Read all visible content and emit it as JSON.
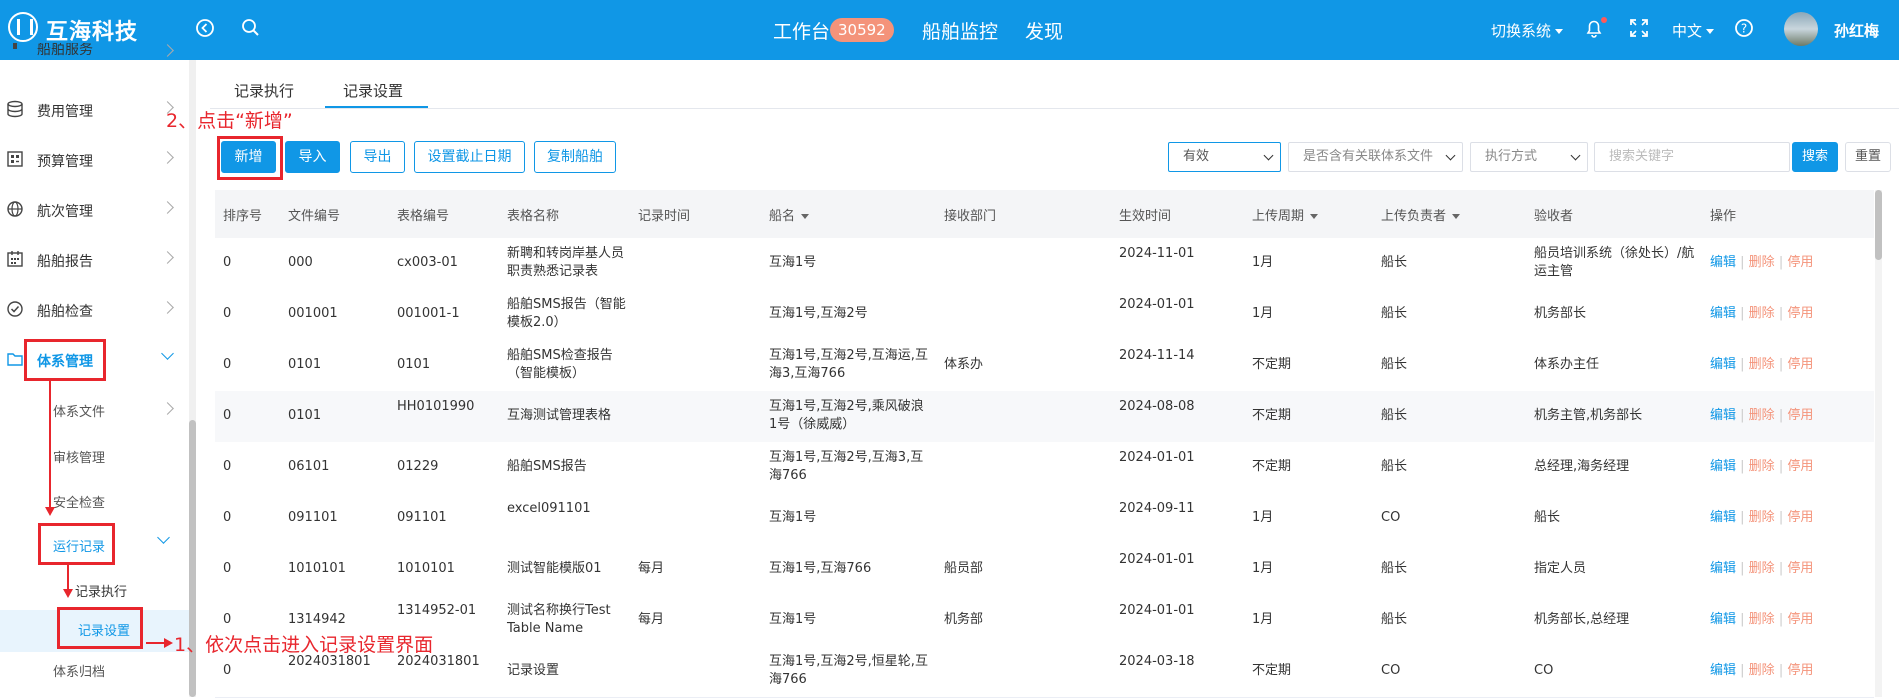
{
  "header": {
    "logo_text": "互海科技",
    "nav": {
      "workbench": "工作台",
      "workbench_count": "30592",
      "ship_monitor": "船舶监控",
      "discover": "发现"
    },
    "switch_system": "切换系统",
    "language": "中文",
    "username": "孙红梅"
  },
  "sidebar": {
    "items": [
      {
        "label": "船舶服务"
      },
      {
        "label": "费用管理"
      },
      {
        "label": "预算管理"
      },
      {
        "label": "航次管理"
      },
      {
        "label": "船舶报告"
      },
      {
        "label": "船舶检查"
      },
      {
        "label": "体系管理"
      }
    ],
    "sub": {
      "system_docs": "体系文件",
      "audit": "审核管理",
      "safety_check": "安全检查",
      "run_record": "运行记录",
      "record_exec": "记录执行",
      "record_settings": "记录设置",
      "archive": "体系归档"
    }
  },
  "annotations": {
    "step2": "2、点击“新增”",
    "step1": "1、依次点击进入记录设置界面"
  },
  "tabs": [
    {
      "label": "记录执行"
    },
    {
      "label": "记录设置"
    }
  ],
  "toolbar": {
    "add": "新增",
    "import": "导入",
    "export": "导出",
    "set_deadline": "设置截止日期",
    "copy_ship": "复制船舶",
    "filter_status": "有效",
    "filter_linked": "是否含有关联体系文件",
    "filter_exec": "执行方式",
    "search_placeholder": "搜索关键字",
    "search": "搜索",
    "reset": "重置"
  },
  "table": {
    "columns": [
      "排序号",
      "文件编号",
      "表格编号",
      "表格名称",
      "记录时间",
      "船名",
      "接收部门",
      "生效时间",
      "上传周期",
      "上传负责者",
      "验收者",
      "操作"
    ],
    "actions": {
      "edit": "编辑",
      "delete": "删除",
      "disable": "停用",
      "sep": "|"
    },
    "rows": [
      {
        "sort": "0",
        "file_no": "000",
        "form_no": "cx003-01",
        "name": "新聘和转岗岸基人员职责熟悉记录表",
        "rec_time": "",
        "ship": "互海1号",
        "dept": "",
        "eff": "2024-11-01",
        "cycle": "1月",
        "uploader": "船长",
        "acceptor": "船员培训系统（徐处长）/航运主管"
      },
      {
        "sort": "0",
        "file_no": "001001",
        "form_no": "001001-1",
        "name": "船舶SMS报告（智能模板2.0）",
        "rec_time": "",
        "ship": "互海1号,互海2号",
        "dept": "",
        "eff": "2024-01-01",
        "cycle": "1月",
        "uploader": "船长",
        "acceptor": "机务部长"
      },
      {
        "sort": "0",
        "file_no": "0101",
        "form_no": "0101",
        "name": "船舶SMS检查报告（智能模板）",
        "rec_time": "",
        "ship": "互海1号,互海2号,互海运,互海3,互海766",
        "dept": "体系办",
        "eff": "2024-11-14",
        "cycle": "不定期",
        "uploader": "船长",
        "acceptor": "体系办主任"
      },
      {
        "sort": "0",
        "file_no": "0101",
        "form_no": "HH0101990",
        "name": "互海测试管理表格",
        "rec_time": "",
        "ship": "互海1号,互海2号,乘风破浪1号（徐威威）",
        "dept": "",
        "eff": "2024-08-08",
        "cycle": "不定期",
        "uploader": "船长",
        "acceptor": "机务主管,机务部长"
      },
      {
        "sort": "0",
        "file_no": "06101",
        "form_no": "01229",
        "name": "船舶SMS报告",
        "rec_time": "",
        "ship": "互海1号,互海2号,互海3,互海766",
        "dept": "",
        "eff": "2024-01-01",
        "cycle": "不定期",
        "uploader": "船长",
        "acceptor": "总经理,海务经理"
      },
      {
        "sort": "0",
        "file_no": "091101",
        "form_no": "091101",
        "name": "excel091101",
        "rec_time": "",
        "ship": "互海1号",
        "dept": "",
        "eff": "2024-09-11",
        "cycle": "1月",
        "uploader": "CO",
        "acceptor": "船长"
      },
      {
        "sort": "0",
        "file_no": "1010101",
        "form_no": "1010101",
        "name": "测试智能模版01",
        "rec_time": "每月",
        "ship": "互海1号,互海766",
        "dept": "船员部",
        "eff": "2024-01-01",
        "cycle": "1月",
        "uploader": "船长",
        "acceptor": "指定人员"
      },
      {
        "sort": "0",
        "file_no": "1314942",
        "form_no": "1314952-01",
        "name": "测试名称换行Test Table Name",
        "rec_time": "每月",
        "ship": "互海1号",
        "dept": "机务部",
        "eff": "2024-01-01",
        "cycle": "1月",
        "uploader": "船长",
        "acceptor": "机务部长,总经理"
      },
      {
        "sort": "0",
        "file_no": "2024031801",
        "form_no": "2024031801",
        "name": "记录设置",
        "rec_time": "",
        "ship": "互海1号,互海2号,恒星轮,互海766",
        "dept": "",
        "eff": "2024-03-18",
        "cycle": "不定期",
        "uploader": "CO",
        "acceptor": "CO"
      }
    ]
  },
  "colors": {
    "brand": "#1097e6",
    "annotation": "#e8262d",
    "badge": "#f4937a"
  }
}
